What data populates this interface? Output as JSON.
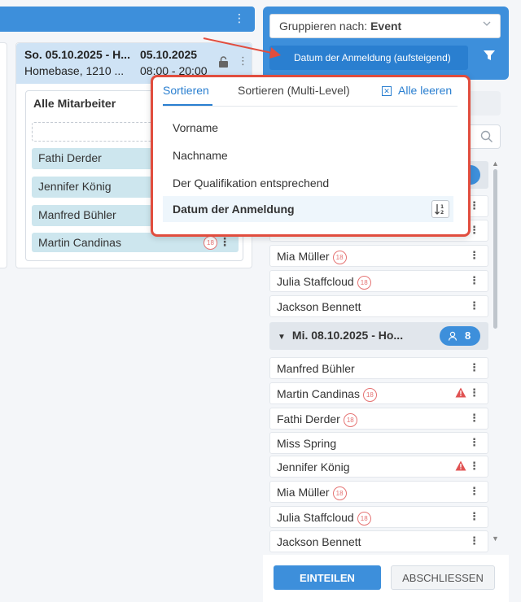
{
  "shift_card": {
    "title_left": "So. 05.10.2025 - H...",
    "title_right": "05.10.2025",
    "subtitle_left": "Homebase, 1210 ...",
    "subtitle_right": "08:00 - 20:00",
    "staff_box_title": "Alle Mitarbeiter",
    "staff": [
      "Fathi Derder",
      "Jennifer König",
      "Manfred Bühler",
      "Martin Candinas"
    ],
    "staff_badge": "18"
  },
  "right_panel": {
    "group_by_label": "Gruppieren nach:",
    "group_by_value": "Event",
    "sort_button_label": "Datum der Anmeldung (aufsteigend)",
    "group1_rows": [
      {
        "name": "Mia Müller",
        "badge": "18",
        "warning": false
      },
      {
        "name": "Julia Staffcloud",
        "badge": "18",
        "warning": false
      },
      {
        "name": "Jackson Bennett",
        "badge": "",
        "warning": false
      }
    ],
    "group2": {
      "title": "Mi. 08.10.2025 - Ho...",
      "count": "8",
      "rows": [
        {
          "name": "Manfred Bühler",
          "badge": "",
          "warning": false
        },
        {
          "name": "Martin Candinas",
          "badge": "18",
          "warning": true
        },
        {
          "name": "Fathi Derder",
          "badge": "18",
          "warning": false
        },
        {
          "name": "Miss Spring",
          "badge": "",
          "warning": false
        },
        {
          "name": "Jennifer König",
          "badge": "",
          "warning": true
        },
        {
          "name": "Mia Müller",
          "badge": "18",
          "warning": false
        },
        {
          "name": "Julia Staffcloud",
          "badge": "18",
          "warning": false
        },
        {
          "name": "Jackson Bennett",
          "badge": "",
          "warning": false
        }
      ]
    },
    "assign_button": "EINTEILEN",
    "finish_button": "ABSCHLIESSEN"
  },
  "sort_popup": {
    "tab_sort": "Sortieren",
    "tab_multi": "Sortieren (Multi-Level)",
    "clear_all": "Alle leeren",
    "options": [
      "Vorname",
      "Nachname",
      "Der Qualifikation entsprechend",
      "Datum der Anmeldung"
    ],
    "selected_option": "Datum der Anmeldung"
  },
  "colors": {
    "accent": "#3d8fdb",
    "highlight_red": "#e14d3e",
    "chip_bg": "#cde6ee",
    "warning": "#e05252"
  }
}
